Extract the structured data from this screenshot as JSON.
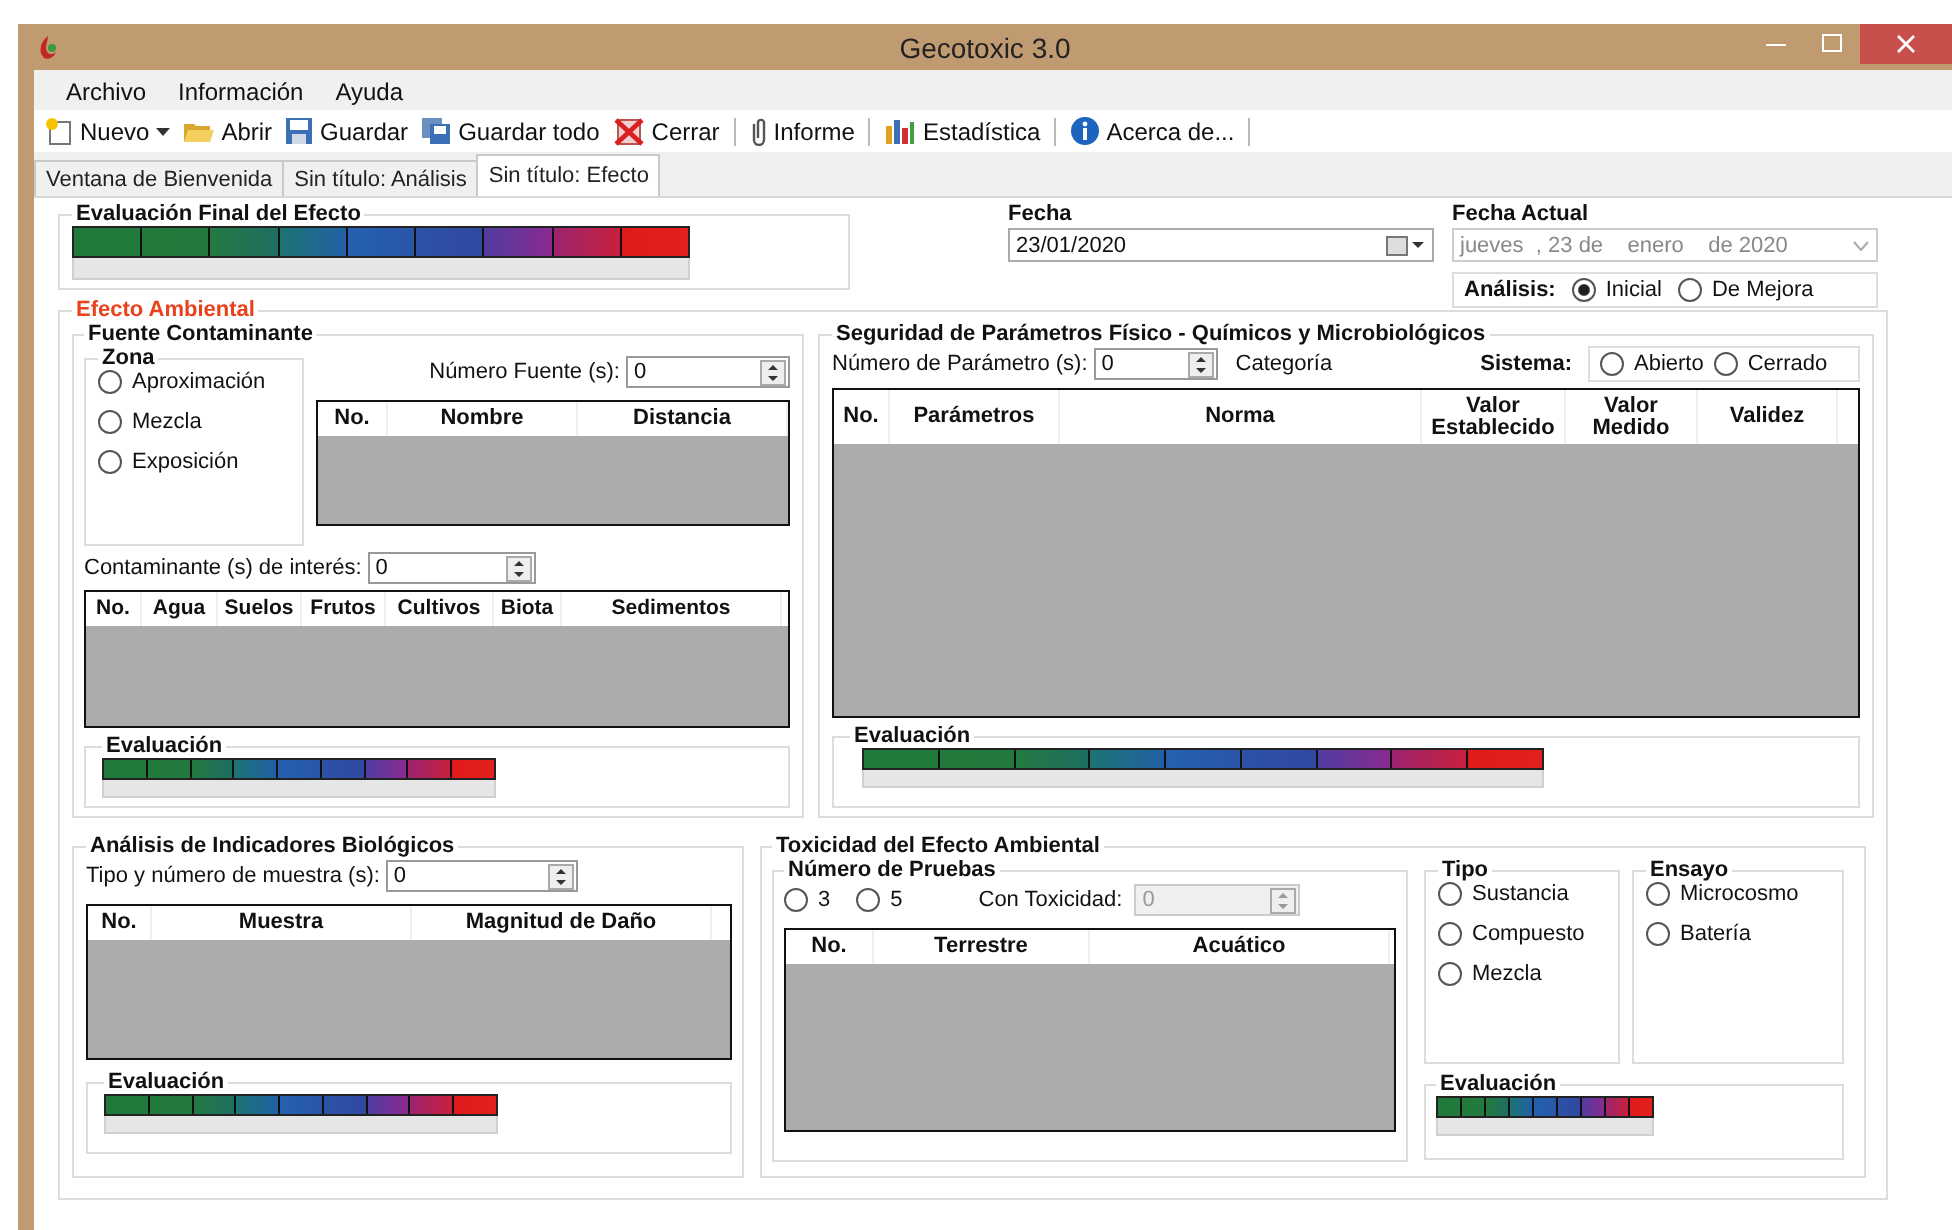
{
  "window": {
    "title": "Gecotoxic 3.0"
  },
  "menu": [
    "Archivo",
    "Información",
    "Ayuda"
  ],
  "toolbar": [
    {
      "kind": "button",
      "label": "Nuevo",
      "dropdown": true
    },
    {
      "kind": "button",
      "label": "Abrir"
    },
    {
      "kind": "button",
      "label": "Guardar"
    },
    {
      "kind": "button",
      "label": "Guardar todo"
    },
    {
      "kind": "button",
      "label": "Cerrar"
    },
    {
      "kind": "separator"
    },
    {
      "kind": "button",
      "label": "Informe"
    },
    {
      "kind": "separator"
    },
    {
      "kind": "button",
      "label": "Estadística"
    },
    {
      "kind": "separator"
    },
    {
      "kind": "button",
      "label": "Acerca de..."
    },
    {
      "kind": "separator"
    }
  ],
  "tabs": [
    {
      "label": "Ventana de Bienvenida",
      "selected": false
    },
    {
      "label": "Sin título: Análisis",
      "selected": false
    },
    {
      "label": "Sin título: Efecto",
      "selected": true
    }
  ],
  "final_evaluation": {
    "title": "Evaluación Final del Efecto"
  },
  "fecha": {
    "label": "Fecha",
    "value": "23/01/2020"
  },
  "fecha_actual": {
    "label": "Fecha Actual",
    "value": "jueves  , 23 de    enero    de 2020",
    "disabled": true
  },
  "analisis": {
    "label": "Análisis:",
    "options": [
      {
        "label": "Inicial",
        "selected": true
      },
      {
        "label": "De Mejora",
        "selected": false
      }
    ]
  },
  "efecto": {
    "title": "Efecto Ambiental",
    "fuente": {
      "title": "Fuente Contaminante",
      "zona": {
        "title": "Zona",
        "options": [
          {
            "label": "Aproximación",
            "selected": false
          },
          {
            "label": "Mezcla",
            "selected": false
          },
          {
            "label": "Exposición",
            "selected": false
          }
        ]
      },
      "numero_fuente": {
        "label": "Número Fuente (s):",
        "value": "0"
      },
      "sources_table": {
        "columns": [
          "No.",
          "Nombre",
          "Distancia"
        ]
      },
      "contaminante": {
        "label": "Contaminante (s) de interés:",
        "value": "0"
      },
      "contaminant_table": {
        "columns": [
          "No.",
          "Agua",
          "Suelos",
          "Frutos",
          "Cultivos",
          "Biota",
          "Sedimentos"
        ]
      },
      "evaluation": {
        "title": "Evaluación"
      }
    },
    "seguridad": {
      "title": "Seguridad de Parámetros Físico - Químicos y Microbiológicos",
      "numero": {
        "label": "Número de Parámetro (s):",
        "value": "0"
      },
      "categoria": "Categoría",
      "sistema": {
        "label": "Sistema:",
        "options": [
          {
            "label": "Abierto",
            "selected": false
          },
          {
            "label": "Cerrado",
            "selected": false
          }
        ]
      },
      "table": {
        "columns": [
          "No.",
          "Parámetros",
          "Norma",
          "Valor Establecido",
          "Valor Medido",
          "Validez"
        ]
      },
      "evaluation": {
        "title": "Evaluación"
      }
    },
    "biologicos": {
      "title": "Análisis de Indicadores Biológicos",
      "muestra": {
        "label": "Tipo y número de muestra (s):",
        "value": "0"
      },
      "table": {
        "columns": [
          "No.",
          "Muestra",
          "Magnitud de Daño"
        ]
      },
      "evaluation": {
        "title": "Evaluación"
      }
    },
    "toxicidad": {
      "title": "Toxicidad del Efecto Ambiental",
      "pruebas": {
        "title": "Número de Pruebas",
        "options": [
          {
            "label": "3",
            "selected": false
          },
          {
            "label": "5",
            "selected": false
          }
        ],
        "con_toxicidad": {
          "label": "Con Toxicidad:",
          "value": "0",
          "disabled": true
        },
        "table": {
          "columns": [
            "No.",
            "Terrestre",
            "Acuático"
          ]
        }
      },
      "tipo": {
        "title": "Tipo",
        "options": [
          {
            "label": "Sustancia",
            "selected": false
          },
          {
            "label": "Compuesto",
            "selected": false
          },
          {
            "label": "Mezcla",
            "selected": false
          }
        ]
      },
      "ensayo": {
        "title": "Ensayo",
        "options": [
          {
            "label": "Microcosmo",
            "selected": false
          },
          {
            "label": "Batería",
            "selected": false
          }
        ]
      },
      "evaluation": {
        "title": "Evaluación"
      }
    }
  }
}
